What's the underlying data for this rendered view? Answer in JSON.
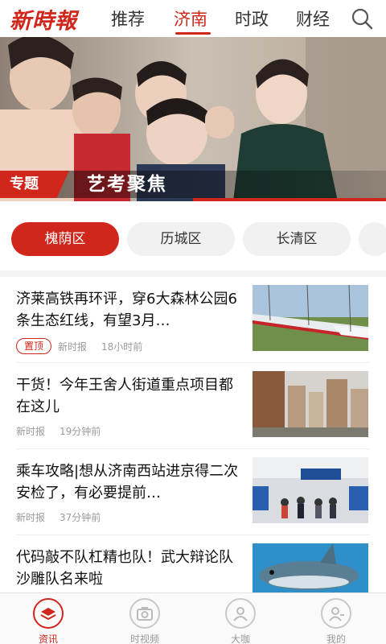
{
  "app": {
    "logo_text": "新時報"
  },
  "nav_tabs": [
    {
      "label": "推荐"
    },
    {
      "label": "济南",
      "active": true
    },
    {
      "label": "时政"
    },
    {
      "label": "财经"
    }
  ],
  "banner": {
    "badge": "专题",
    "title": "艺考聚焦",
    "progress_fraction": 0.5
  },
  "districts": [
    {
      "label": "槐荫区",
      "active": true
    },
    {
      "label": "历城区"
    },
    {
      "label": "长清区"
    }
  ],
  "news": [
    {
      "title": "济莱高铁再环评，穿6大森林公园6条生态红线，有望3月…",
      "pinned_label": "置顶",
      "source": "新时报",
      "time": "18小时前",
      "thumb": "high-speed-train"
    },
    {
      "title": "干货！今年王舍人街道重点项目都在这儿",
      "source": "新时报",
      "time": "19分钟前",
      "thumb": "residential-towers"
    },
    {
      "title": "乘车攻略|想从济南西站进京得二次安检了，有必要提前…",
      "source": "新时报",
      "time": "37分钟前",
      "thumb": "train-station-hall"
    },
    {
      "title": "代码敲不队杠精也队！武大辩论队沙雕队名来啦",
      "source": "",
      "time": "",
      "thumb": "shark"
    }
  ],
  "bottom_nav": [
    {
      "label": "资讯",
      "icon": "news-stack-icon",
      "active": true
    },
    {
      "label": "时视频",
      "icon": "camera-icon"
    },
    {
      "label": "大咖",
      "icon": "person-icon"
    },
    {
      "label": "我的",
      "icon": "profile-icon"
    }
  ],
  "colors": {
    "accent": "#d0261b",
    "pill_bg": "#f1f1f1",
    "muted_text": "#9a9a9a"
  }
}
